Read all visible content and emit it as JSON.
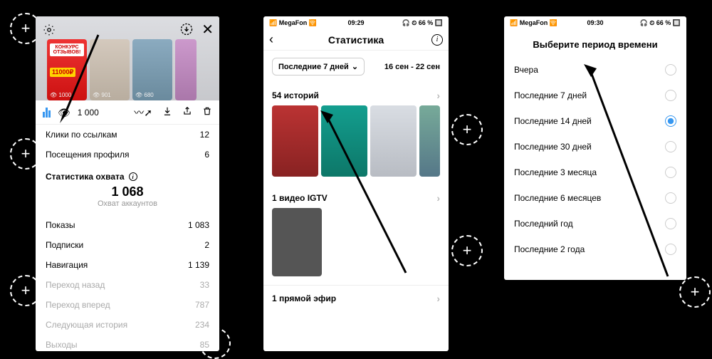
{
  "panel1": {
    "story_badge": "11000₽",
    "story_header": "КОНКУРС ОТЗЫВОВ!",
    "story_view_1": "901",
    "story_view_2": "680",
    "views_count": "1 000",
    "row_clicks_label": "Клики по ссылкам",
    "row_clicks_value": "12",
    "row_profile_label": "Посещения профиля",
    "row_profile_value": "6",
    "section_reach": "Статистика охвата",
    "reach_num": "1 068",
    "reach_sub": "Охват аккаунтов",
    "row_imp_label": "Показы",
    "row_imp_value": "1 083",
    "row_follow_label": "Подписки",
    "row_follow_value": "2",
    "row_nav_label": "Навигация",
    "row_nav_value": "1 139",
    "row_back_label": "Переход назад",
    "row_back_value": "33",
    "row_fwd_label": "Переход вперед",
    "row_fwd_value": "787",
    "row_next_label": "Следующая история",
    "row_next_value": "234",
    "row_exit_label": "Выходы",
    "row_exit_value": "85"
  },
  "panel2": {
    "carrier": "MegaFon",
    "time": "09:29",
    "battery": "66 %",
    "title": "Статистика",
    "period_label": "Последние 7 дней",
    "date_range": "16 сен - 22 сен",
    "stories_count": "54 историй",
    "igtv_count": "1 видео IGTV",
    "live_count": "1 прямой эфир"
  },
  "panel3": {
    "carrier": "MegaFon",
    "time": "09:30",
    "battery": "66 %",
    "title": "Выберите период времени",
    "opt0": "Вчера",
    "opt1": "Последние 7 дней",
    "opt2": "Последние 14 дней",
    "opt3": "Последние 30 дней",
    "opt4": "Последние 3 месяца",
    "opt5": "Последние 6 месяцев",
    "opt6": "Последний год",
    "opt7": "Последние 2 года"
  }
}
